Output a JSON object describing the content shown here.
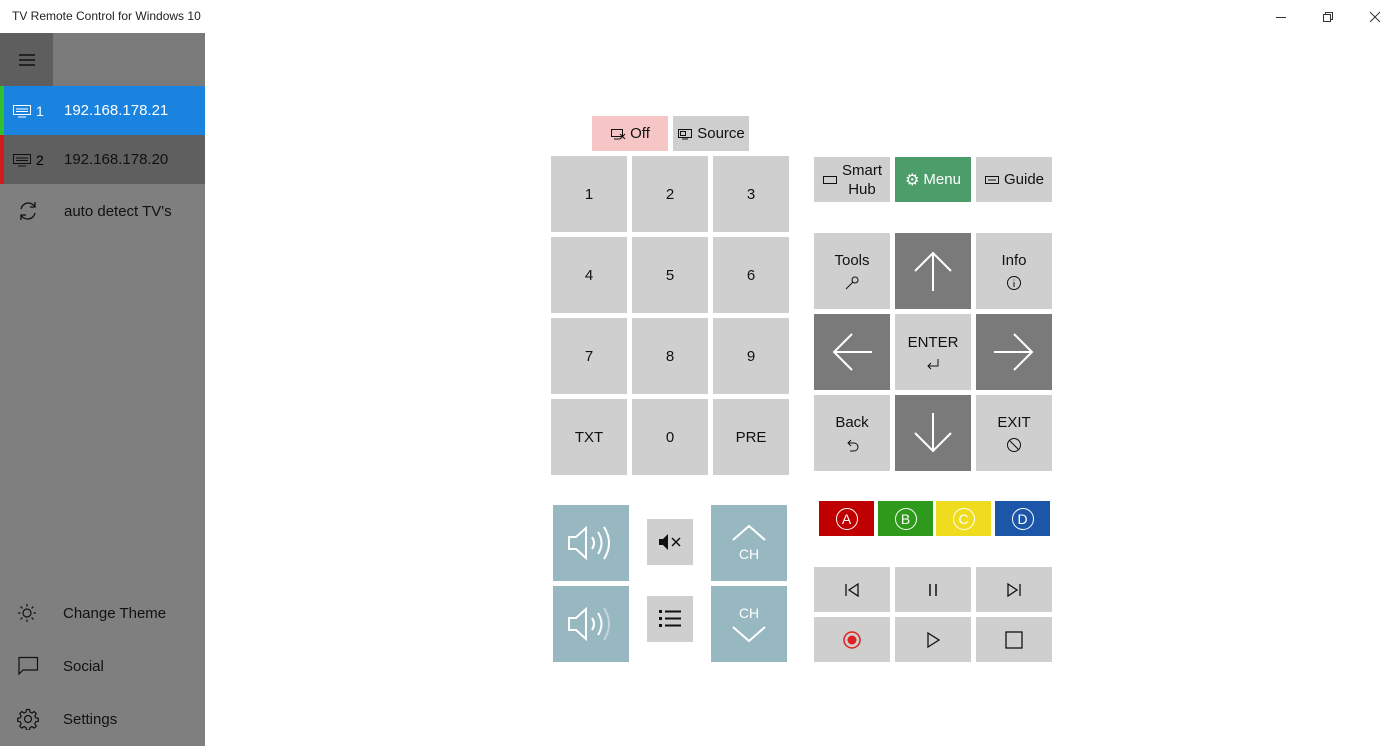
{
  "window": {
    "title": "TV Remote Control for Windows 10",
    "controls": [
      "minimize-icon",
      "restore-icon",
      "close-icon"
    ]
  },
  "sidebar": {
    "menu_icon": "hamburger-icon",
    "tvs": [
      {
        "number": "1",
        "ip": "192.168.178.21",
        "indicator_color": "#2fbf2f",
        "selected": true
      },
      {
        "number": "2",
        "ip": "192.168.178.20",
        "indicator_color": "#d11a1a",
        "selected": false
      }
    ],
    "auto_detect": "auto detect TV's",
    "bottom": [
      {
        "icon": "sun-icon",
        "label": "Change Theme"
      },
      {
        "icon": "chat-icon",
        "label": "Social"
      },
      {
        "icon": "gear-icon",
        "label": "Settings"
      }
    ]
  },
  "remote": {
    "power": {
      "off_label": "Off",
      "source_label": "Source"
    },
    "numpad": [
      "1",
      "2",
      "3",
      "4",
      "5",
      "6",
      "7",
      "8",
      "9",
      "TXT",
      "0",
      "PRE"
    ],
    "top_row": {
      "smart_hub_line1": "Smart",
      "smart_hub_line2": "Hub",
      "menu": "Menu",
      "guide": "Guide"
    },
    "nav": {
      "tools": "Tools",
      "info": "Info",
      "enter": "ENTER",
      "back": "Back",
      "exit": "EXIT"
    },
    "channel": {
      "up": "CH",
      "down": "CH"
    },
    "colors": [
      {
        "letter": "A",
        "color": "#c00000"
      },
      {
        "letter": "B",
        "color": "#2e9a1c"
      },
      {
        "letter": "C",
        "color": "#f0dc1e"
      },
      {
        "letter": "D",
        "color": "#1b56a8"
      }
    ],
    "accent_colors": {
      "button": "#cfcfcf",
      "dark": "#7a7a7a",
      "volume": "#97b7c1",
      "menu": "#4d9d6a",
      "off": "#f6c6c6",
      "record": "#e02020"
    }
  }
}
